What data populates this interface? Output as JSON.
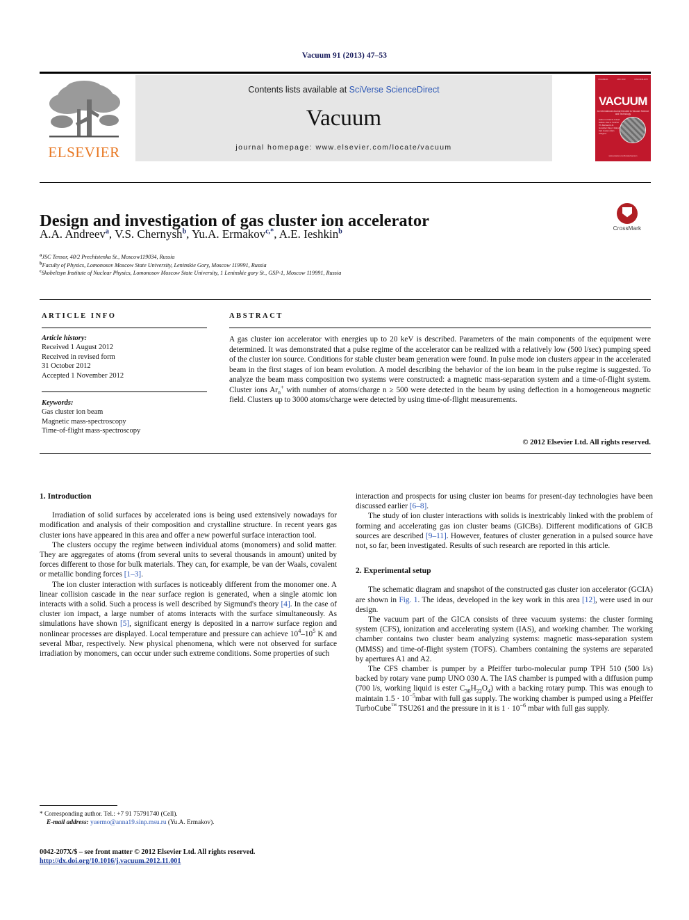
{
  "running_head": "Vacuum 91 (2013) 47–53",
  "masthead": {
    "contents_prefix": "Contents lists available at ",
    "sciencedirect_link": "SciVerse ScienceDirect",
    "journal_name": "Vacuum",
    "homepage": "journal homepage: www.elsevier.com/locate/vacuum",
    "publisher_logo_text": "ELSEVIER",
    "cover": {
      "title": "VACUUM",
      "subtitle": "An International Journal Devoted to Vacuum Science and Technology",
      "top_left": "VOLUME 91",
      "top_mid": "MAY 2013",
      "top_right": "ISSN 0042-207X",
      "editors": "Editor-in-Chief\nR.J. Reid\n\nEditors\nJose A. Sobrino\nPh. Bertrand\nA.R. González\nOleg I. Malyshev\nKarl Jousten\nAlain Chagnes",
      "footer": "www.elsevier.com/locate/vacuum"
    }
  },
  "article": {
    "title": "Design and investigation of gas cluster ion accelerator",
    "authors": [
      {
        "name": "A.A. Andreev",
        "marks": "a"
      },
      {
        "name": "V.S. Chernysh",
        "marks": "b"
      },
      {
        "name": "Yu.A. Ermakov",
        "marks": "c,*"
      },
      {
        "name": "A.E. Ieshkin",
        "marks": "b"
      }
    ],
    "affiliations": [
      {
        "mark": "a",
        "text": "JSC Tensor, 40/2 Prechistenka St., Moscow119034, Russia"
      },
      {
        "mark": "b",
        "text": "Faculty of Physics, Lomonosov Moscow State University, Leninskie Gory, Moscow 119991, Russia"
      },
      {
        "mark": "c",
        "text": "Skobeltsyn Institute of Nuclear Physics, Lomonosov Moscow State University, 1 Leninskie gory St., GSP-1, Moscow 119991, Russia"
      }
    ],
    "crossmark_label": "CrossMark"
  },
  "info": {
    "heading": "ARTICLE INFO",
    "history_label": "Article history:",
    "history": [
      "Received 1 August 2012",
      "Received in revised form",
      "31 October 2012",
      "Accepted 1 November 2012"
    ],
    "keywords_label": "Keywords:",
    "keywords": [
      "Gas cluster ion beam",
      "Magnetic mass-spectroscopy",
      "Time-of-flight mass-spectroscopy"
    ]
  },
  "abstract": {
    "heading": "ABSTRACT",
    "paragraph_1": "A gas cluster ion accelerator with energies up to 20 keV is described. Parameters of the main components of the equipment were determined. It was demonstrated that a pulse regime of the accelerator can be realized with a relatively low (500 l/sec) pumping speed of the cluster ion source. Conditions for stable cluster beam generation were found. In pulse mode ion clusters appear in the accelerated beam in the first stages of ion beam evolution. A model describing the behavior of the ion beam in the pulse regime is suggested. To analyze the beam mass composition two systems were constructed: a magnetic mass-separation system and a time-of-flight system. Cluster ions Ar",
    "formula_sub": "n",
    "formula_sup": "+",
    "paragraph_2": " with number of atoms/charge n ≥ 500 were detected in the beam by using deflection in a homogeneous magnetic field. Clusters up to 3000 atoms/charge were detected by using time-of-flight measurements.",
    "copyright": "© 2012 Elsevier Ltd. All rights reserved."
  },
  "body": {
    "section1_heading": "1.  Introduction",
    "s1_p1": "Irradiation of solid surfaces by accelerated ions is being used extensively nowadays for modification and analysis of their composition and crystalline structure. In recent years gas cluster ions have appeared in this area and offer a new powerful surface interaction tool.",
    "s1_p2_a": "The clusters occupy the regime between individual atoms (monomers) and solid matter. They are aggregates of atoms (from several units to several thousands in amount) united by forces different to those for bulk materials. They can, for example, be van der Waals, covalent or metallic bonding forces ",
    "s1_p2_ref": "[1–3]",
    "s1_p2_b": ".",
    "s1_p3_a": "The ion cluster interaction with surfaces is noticeably different from the monomer one. A linear collision cascade in the near surface region is generated, when a single atomic ion interacts with a solid. Such a process is well described by Sigmund's theory ",
    "s1_p3_ref1": "[4]",
    "s1_p3_b": ". In the case of cluster ion impact, a large number of atoms interacts with the surface simultaneously. As simulations have shown ",
    "s1_p3_ref2": "[5]",
    "s1_p3_c": ", significant energy is deposited in a narrow surface region and nonlinear processes are displayed. Local temperature and pressure can achieve 10",
    "s1_p3_sup1": "4",
    "s1_p3_d": "–10",
    "s1_p3_sup2": "5",
    "s1_p3_e": " K and several Mbar, respectively. New physical phenomena, which were not observed for surface irradiation by monomers, can occur under such extreme conditions. Some properties of such",
    "s1_p4_a": "interaction and prospects for using cluster ion beams for present-day technologies have been discussed earlier ",
    "s1_p4_ref": "[6–8]",
    "s1_p4_b": ".",
    "s1_p5_a": "The study of ion cluster interactions with solids is inextricably linked with the problem of forming and accelerating gas ion cluster beams (GICBs). Different modifications of GICB sources are described ",
    "s1_p5_ref": "[9–11]",
    "s1_p5_b": ". However, features of cluster generation in a pulsed source have not, so far, been investigated. Results of such research are reported in this article.",
    "section2_heading": "2.  Experimental setup",
    "s2_p1_a": "The schematic diagram and snapshot of the constructed gas cluster ion accelerator (GCIA) are shown in ",
    "s2_p1_fig": "Fig. 1",
    "s2_p1_b": ". The ideas, developed in the key work in this area ",
    "s2_p1_ref": "[12]",
    "s2_p1_c": ", were used in our design.",
    "s2_p2": "The vacuum part of the GICA consists of three vacuum systems: the cluster forming system (CFS), ionization and accelerating system (IAS), and working chamber. The working chamber contains two cluster beam analyzing systems: magnetic mass-separation system (MMSS) and time-of-flight system (TOFS). Chambers containing the systems are separated by apertures A1 and A2.",
    "s2_p3_a": "The CFS chamber is pumper by a Pfeiffer turbo-molecular pump TPH 510 (500 l/s) backed by rotary vane pump UNO 030 A. The IAS chamber is pumped with a diffusion pump (700 l/s, working liquid is ester C",
    "s2_p3_sub1": "30",
    "s2_p3_b": "H",
    "s2_p3_sub2": "22",
    "s2_p3_c": "O",
    "s2_p3_sub3": "4",
    "s2_p3_d": ") with a backing rotary pump. This was enough to maintain 1.5 · 10",
    "s2_p3_sup1": "−5",
    "s2_p3_e": "mbar with full gas supply. The working chamber is pumped using a Pfeiffer TurboCube",
    "s2_p3_tm": "™",
    "s2_p3_f": " TSU261 and the pressure in it is 1 · 10",
    "s2_p3_sup2": "−6",
    "s2_p3_g": " mbar with full gas supply."
  },
  "footer": {
    "corresponding_marker": "*",
    "corresponding_text": "Corresponding author. Tel.: +7 91 75791740 (Cell).",
    "email_label": "E-mail address:",
    "email": "yuermo@anna19.sinp.msu.ru",
    "email_owner": "(Yu.A. Ermakov).",
    "imprint": "0042-207X/$ – see front matter © 2012 Elsevier Ltd. All rights reserved.",
    "doi": "http://dx.doi.org/10.1016/j.vacuum.2012.11.001"
  }
}
